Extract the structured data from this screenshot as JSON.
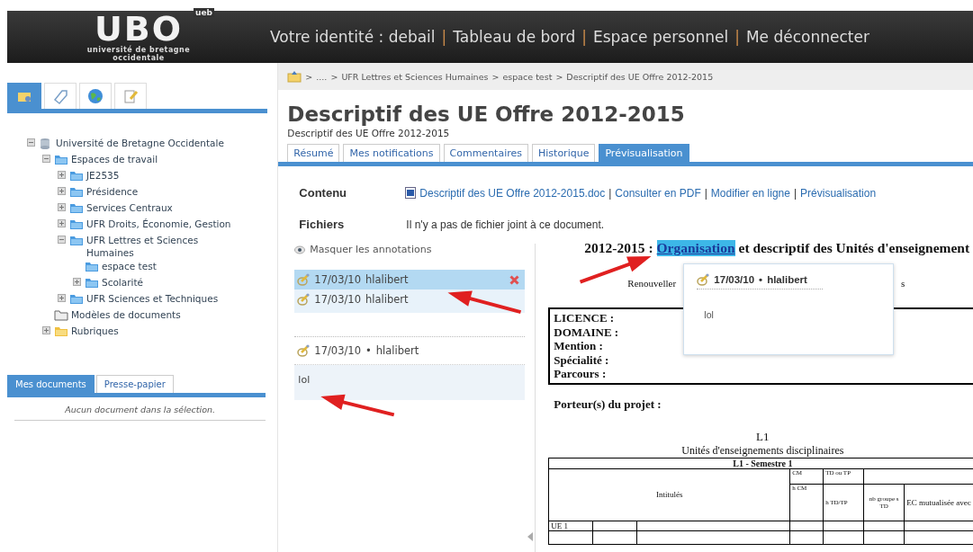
{
  "header": {
    "logo": "UBO",
    "logo_badge": "ueb",
    "logo_subtitle": "université de bretagne occidentale",
    "separator": "|",
    "links": [
      {
        "label": "Votre identité : debail"
      },
      {
        "label": "Tableau de bord"
      },
      {
        "label": "Espace personnel"
      },
      {
        "label": "Me déconnecter"
      }
    ]
  },
  "sidebar": {
    "icon_tabs": [
      {
        "kind": "folders",
        "selected": true
      },
      {
        "kind": "tag",
        "selected": false
      },
      {
        "kind": "globe",
        "selected": false
      },
      {
        "kind": "notes",
        "selected": false
      }
    ],
    "tree": [
      {
        "label": "Université de Bretagne Occidentale",
        "kind": "database",
        "expanded": true,
        "children": [
          {
            "label": "Espaces de travail",
            "kind": "folder",
            "expanded": true,
            "children": [
              {
                "label": "JE2535",
                "kind": "folder",
                "expanded": false
              },
              {
                "label": "Présidence",
                "kind": "folder",
                "expanded": false
              },
              {
                "label": "Services Centraux",
                "kind": "folder",
                "expanded": false
              },
              {
                "label": "UFR Droits, Économie, Gestion",
                "kind": "folder",
                "expanded": false
              },
              {
                "label": "UFR Lettres et Sciences Humaines",
                "kind": "folder",
                "expanded": true,
                "children": [
                  {
                    "label": "espace test",
                    "kind": "folder"
                  },
                  {
                    "label": "Scolarité",
                    "kind": "folder",
                    "expanded": false
                  }
                ]
              },
              {
                "label": "UFR Sciences et Techniques",
                "kind": "folder",
                "expanded": false
              }
            ]
          },
          {
            "label": "Modèles de documents",
            "kind": "template"
          },
          {
            "label": "Rubriques",
            "kind": "category",
            "expanded": false
          }
        ]
      }
    ],
    "doc_tabs": [
      {
        "label": "Mes documents",
        "selected": true
      },
      {
        "label": "Presse-papier",
        "selected": false
      }
    ],
    "empty_message": "Aucun document dans la sélection."
  },
  "breadcrumb": {
    "separator": ">",
    "items": [
      "....",
      "UFR Lettres et Sciences Humaines",
      "espace test",
      "Descriptif des UE Offre 2012-2015"
    ]
  },
  "title": "Descriptif des UE Offre 2012-2015",
  "subtitle": "Descriptif des UE Offre 2012-2015",
  "tabs": [
    {
      "label": "Résumé",
      "selected": false
    },
    {
      "label": "Mes notifications",
      "selected": false
    },
    {
      "label": "Commentaires",
      "selected": false
    },
    {
      "label": "Historique",
      "selected": false
    },
    {
      "label": "Prévisualisation",
      "selected": true
    }
  ],
  "contenu": {
    "label": "Contenu",
    "separator": "|",
    "links": [
      "Descriptif des UE Offre 2012-2015.doc",
      "Consulter en PDF",
      "Modifier en ligne",
      "Prévisualisation"
    ]
  },
  "fichiers": {
    "label": "Fichiers",
    "text": "Il n'y a pas de fichier joint à ce document."
  },
  "annotations": {
    "toggle": "Masquer les annotations",
    "items": [
      {
        "date": "17/03/10",
        "author": "hlalibert",
        "selected": true
      },
      {
        "date": "17/03/10",
        "author": "hlalibert",
        "selected": false
      }
    ],
    "detail": {
      "date": "17/03/10",
      "separator": "•",
      "author": "hlalibert",
      "body": "lol"
    }
  },
  "document": {
    "heading_before": "2012-2015 : ",
    "heading_highlight": "Organisation",
    "heading_after": "et descriptif des Unités d'enseignement",
    "line_start": "Renouveller",
    "line_end": "s",
    "fields": [
      "LICENCE :",
      "DOMAINE :",
      "Mention :",
      "Spécialité :",
      "Parcours :"
    ],
    "porteurs": "Porteur(s) du projet :",
    "level": "L1",
    "table_title": "Unités d'enseignements disciplinaires",
    "table": {
      "semester": "L1 - Semestre 1",
      "intitules": "Intitulés",
      "cm": "CM",
      "td": "TD ou TP",
      "h_cm": "h CM",
      "h_td": "h TD/TP",
      "nb_groupes": "nb groupe s TD",
      "ec": "EC mutualisée avec",
      "ue": "UE 1"
    }
  },
  "popup": {
    "date": "17/03/10",
    "separator": "•",
    "author": "hlalibert",
    "body": "lol"
  }
}
